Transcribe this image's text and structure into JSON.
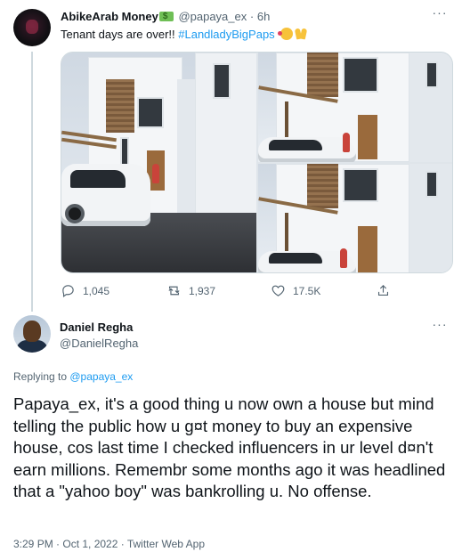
{
  "parent_tweet": {
    "display_name": "AbikeArab Money",
    "name_emoji_icon": "money-with-wings-icon",
    "handle": "@papaya_ex",
    "separator": "·",
    "time": "6h",
    "text_prefix": "Tenant days are over!! ",
    "hashtag": "#LandladyBigPaps",
    "trailing_emoji_icons": [
      "smiling-face-with-hearts-icon",
      "folded-hands-icon"
    ],
    "media_count": 3,
    "actions": {
      "replies": "1,045",
      "retweets": "1,937",
      "likes": "17.5K"
    }
  },
  "reply_tweet": {
    "display_name": "Daniel Regha",
    "handle": "@DanielRegha",
    "replying_label": "Replying to ",
    "replying_to": "@papaya_ex",
    "text": "Papaya_ex, it's a good thing u now own a house but mind telling the public how u g¤t money to buy an expensive house, cos last time I checked influencers in ur level d¤n't earn millions. Remembr some months ago it was headlined that a \"yahoo boy\" was bankrolling u. No offense.",
    "timestamp": "3:29 PM · Oct 1, 2022 · Twitter Web App"
  },
  "colors": {
    "accent": "#1d9bf0",
    "secondary_text": "#536471",
    "primary_text": "#0f1419",
    "thread_line": "#cfd9de"
  }
}
